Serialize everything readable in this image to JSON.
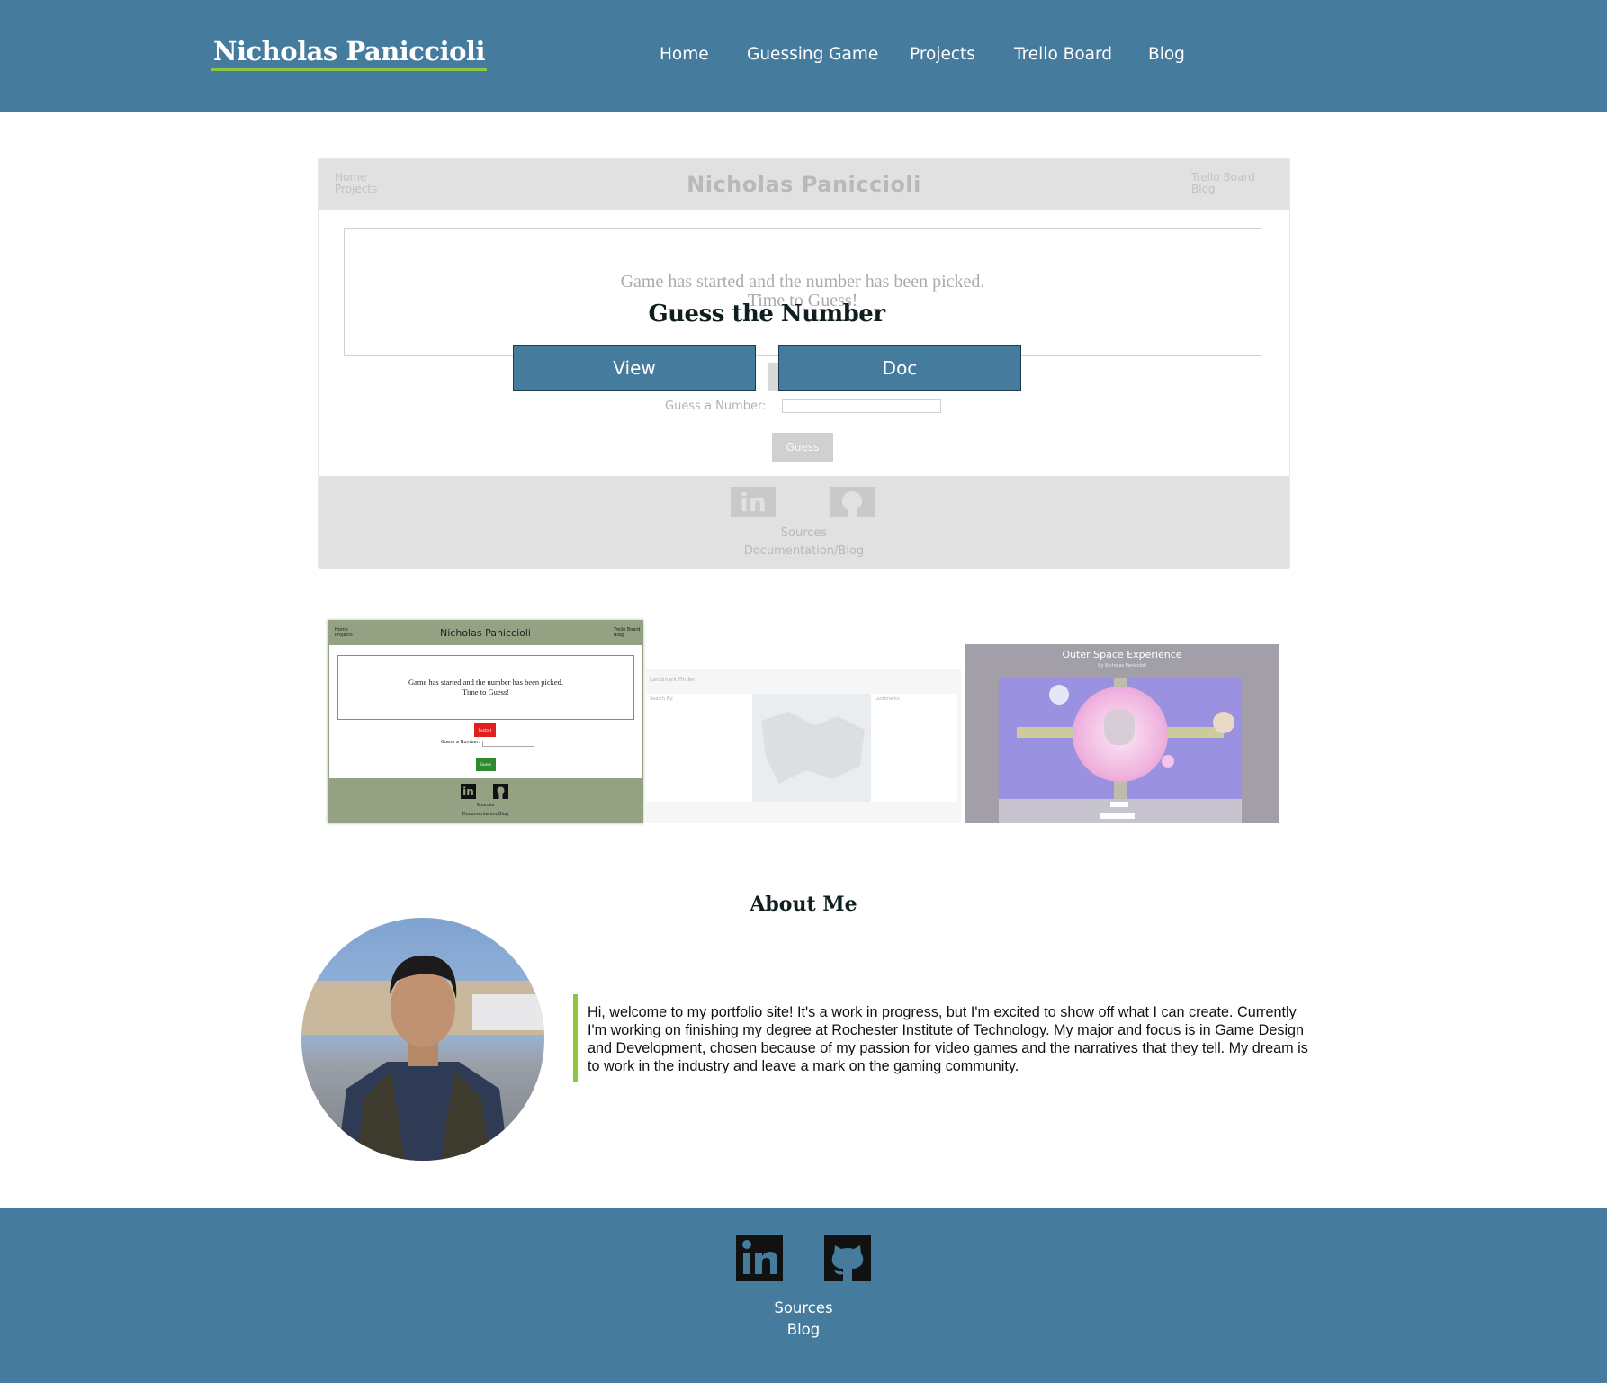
{
  "header": {
    "brand": "Nicholas Paniccioli",
    "nav": [
      "Home",
      "Guessing Game",
      "Projects",
      "Trello Board",
      "Blog"
    ]
  },
  "featured": {
    "preview": {
      "nav_left": [
        "Home",
        "Projects"
      ],
      "title": "Nicholas Paniccioli",
      "nav_right": [
        "Trello Board",
        "Blog"
      ],
      "message_line1": "Game has started and the number has been picked.",
      "message_line2": "Time to Guess!",
      "guess_label": "Guess a Number:",
      "guess_button": "Guess",
      "footer_links": [
        "Sources",
        "Documentation/Blog"
      ]
    },
    "title": "Guess the Number",
    "buttons": [
      "View",
      "Doc"
    ]
  },
  "thumbnails": {
    "guess": {
      "nav_left": [
        "Home",
        "Projects"
      ],
      "title": "Nicholas Paniccioli",
      "nav_right": [
        "Trello Board",
        "Blog"
      ],
      "message_line1": "Game has started and the number has been picked.",
      "message_line2": "Time to Guess!",
      "restart": "Restart",
      "guess_label": "Guess a Number:",
      "guess_button": "Guess",
      "footer_links": [
        "Sources",
        "Documentation/Blog"
      ]
    },
    "landmark": {
      "title": "Landmark Finder",
      "search_label": "Search By:",
      "results_label": "Landmarks"
    },
    "space": {
      "title": "Outer Space Experience",
      "subtitle": "By Nicholas Paniccioli"
    }
  },
  "about": {
    "title": "About Me",
    "text": "Hi, welcome to my portfolio site! It's a work in progress, but I'm excited to show off what I can create. Currently I'm working on finishing my degree at Rochester Institute of Technology. My major and focus is in Game Design and Development, chosen because of my passion for video games and the narratives that they tell. My dream is to work in the industry and leave a mark on the gaming community."
  },
  "footer": {
    "links": [
      "Sources",
      "Blog"
    ],
    "icons": [
      "linkedin-icon",
      "github-icon"
    ]
  },
  "colors": {
    "primary": "#457b9d",
    "accent": "#8dc63f",
    "thumb_green": "#94a183"
  }
}
